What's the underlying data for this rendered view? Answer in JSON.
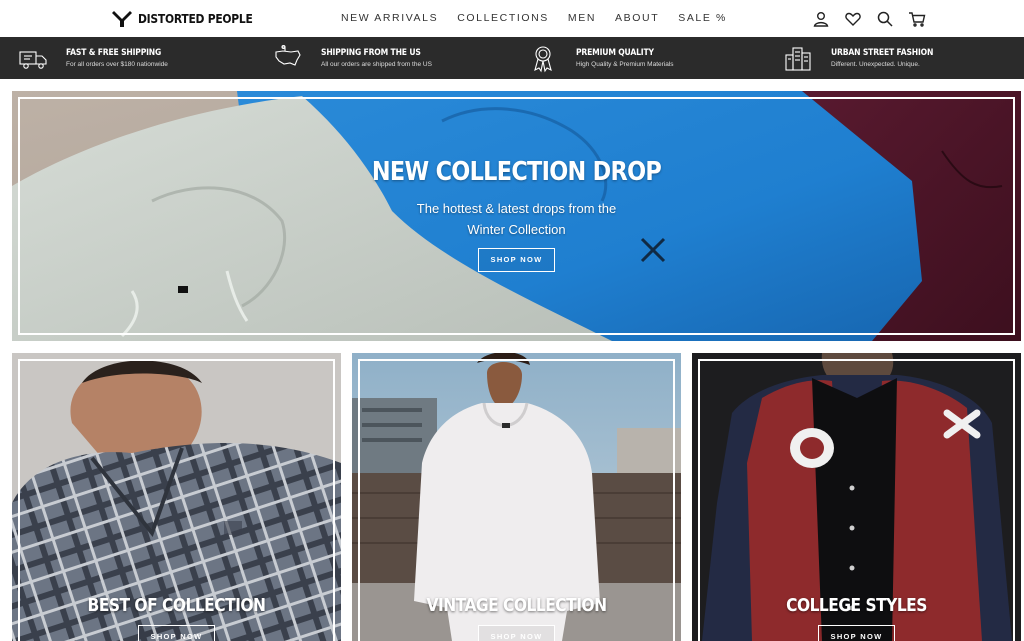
{
  "header": {
    "logo_text": "DISTORTED PEOPLE",
    "nav": [
      "NEW ARRIVALS",
      "COLLECTIONS",
      "MEN",
      "ABOUT",
      "SALE %"
    ],
    "icons": [
      "user-icon",
      "heart-icon",
      "search-icon",
      "cart-icon"
    ]
  },
  "benefits": [
    {
      "icon": "delivery-truck-icon",
      "title": "FAST & FREE SHIPPING",
      "subtitle": "For all orders over $180 nationwide"
    },
    {
      "icon": "usa-map-icon",
      "title": "SHIPPING FROM THE US",
      "subtitle": "All our orders are shipped from the US"
    },
    {
      "icon": "award-ribbon-icon",
      "title": "PREMIUM QUALITY",
      "subtitle": "High Quality & Premium Materials"
    },
    {
      "icon": "city-buildings-icon",
      "title": "URBAN STREET FASHION",
      "subtitle": "Different. Unexpected. Unique."
    }
  ],
  "hero": {
    "title": "NEW COLLECTION DROP",
    "subtitle_line1": "The hottest & latest drops from the",
    "subtitle_line2": "Winter Collection",
    "button": "SHOP NOW"
  },
  "tiles": [
    {
      "title": "BEST OF COLLECTION",
      "button": "SHOP NOW"
    },
    {
      "title": "VINTAGE COLLECTION",
      "button": "SHOP NOW"
    },
    {
      "title": "COLLEGE STYLES",
      "button": "SHOP NOW"
    }
  ],
  "colors": {
    "benefits_bar": "#2b2b2b",
    "text_dark": "#111111",
    "hoodie_blue": "#1f7fd0",
    "hoodie_grey": "#c9cfc9",
    "jacket_red": "#8e2a2c"
  }
}
